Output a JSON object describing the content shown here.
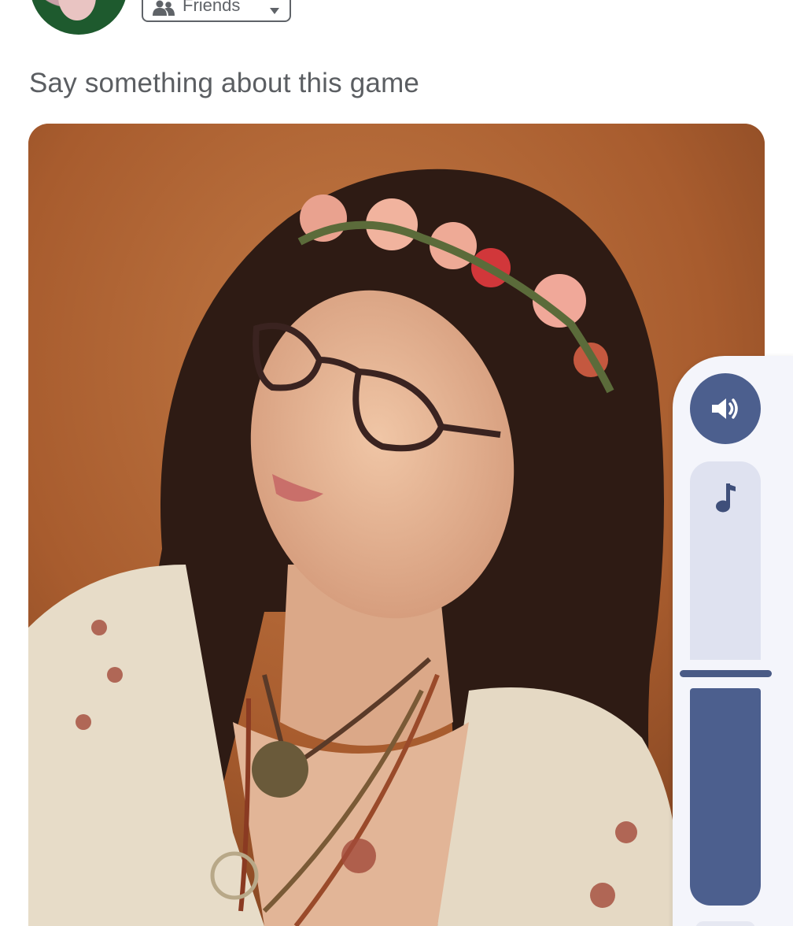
{
  "header": {
    "audience_label": "Friends"
  },
  "composer": {
    "prompt_text": "Say something about this game"
  },
  "audio_controls": {
    "volume_level_percent": 55,
    "accent_color": "#4c5f8e",
    "track_color": "#dfe2f0",
    "icons": {
      "sound": "speaker-icon",
      "music": "music-note-icon"
    }
  },
  "colors": {
    "prompt_text": "#5b5e62",
    "panel_bg": "#f4f5fb"
  }
}
